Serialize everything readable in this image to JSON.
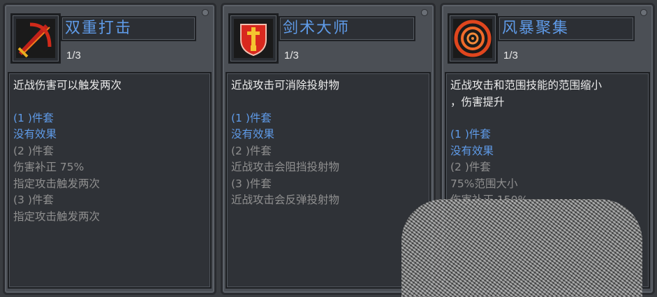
{
  "cards": [
    {
      "icon": "double-strike-icon",
      "title": "双重打击",
      "count": "1/3",
      "desc": "近战伤害可以触发两次",
      "tiers": [
        {
          "label": "(1 )件套",
          "lines": [
            "没有效果"
          ],
          "active": true
        },
        {
          "label": "(2 )件套",
          "lines": [
            "伤害补正 75%",
            "指定攻击触发两次"
          ],
          "active": false
        },
        {
          "label": "(3 )件套",
          "lines": [
            "指定攻击触发两次"
          ],
          "active": false
        }
      ]
    },
    {
      "icon": "sword-master-icon",
      "title": "剑术大师",
      "count": "1/3",
      "desc": "近战攻击可消除投射物",
      "tiers": [
        {
          "label": "(1 )件套",
          "lines": [
            "没有效果"
          ],
          "active": true
        },
        {
          "label": "(2 )件套",
          "lines": [
            "近战攻击会阻挡投射物"
          ],
          "active": false
        },
        {
          "label": "(3 )件套",
          "lines": [
            "近战攻击会反弹投射物"
          ],
          "active": false
        }
      ]
    },
    {
      "icon": "storm-focus-icon",
      "title": "风暴聚集",
      "count": "1/3",
      "desc": "近战攻击和范围技能的范围缩小\n，伤害提升",
      "tiers": [
        {
          "label": "(1 )件套",
          "lines": [
            "没有效果"
          ],
          "active": true
        },
        {
          "label": "(2 )件套",
          "lines": [
            "75%范围大小",
            "伤害补正 150%"
          ],
          "active": false
        }
      ]
    }
  ],
  "colors": {
    "active": "#5f9be8",
    "inactive": "#8f8f8f",
    "desc": "#ececec"
  }
}
